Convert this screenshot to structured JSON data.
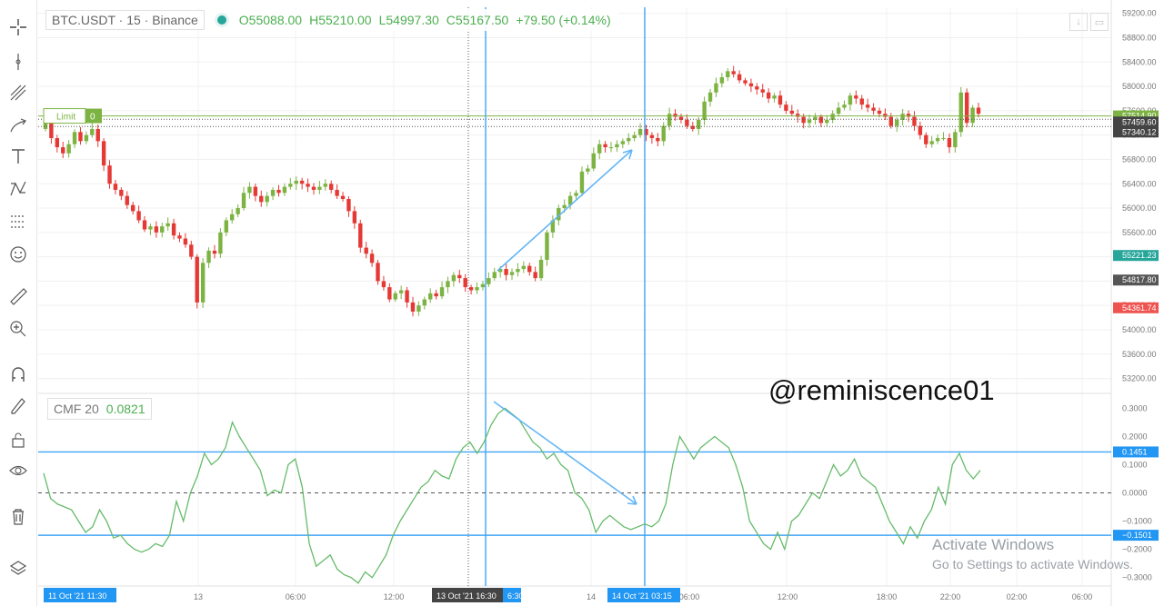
{
  "header": {
    "symbol": "BTC.USDT · 15 · Binance",
    "open": "O55088.00",
    "high": "H55210.00",
    "low": "L54997.30",
    "close": "C55167.50",
    "change": "+79.50 (+0.14%)"
  },
  "order_label": {
    "text": "Limit",
    "qty": "0"
  },
  "indicator": {
    "name": "CMF 20",
    "value": "0.0821"
  },
  "watermark": "@reminiscence01",
  "windows_notice": {
    "title": "Activate Windows",
    "subtitle": "Go to Settings to activate Windows."
  },
  "toolbar_icons": [
    "crosshair-icon",
    "line-tool-icon",
    "fib-tool-icon",
    "brush-icon",
    "text-tool-icon",
    "pattern-icon",
    "measure-grid-icon",
    "emoji-icon",
    "ruler-icon",
    "zoom-in-icon",
    "magnet-icon",
    "draw-lock-icon",
    "lock-icon",
    "eye-icon",
    "trash-icon",
    "layers-icon"
  ],
  "price_axis_ticks": [
    "59200.00",
    "58800.00",
    "58400.00",
    "58000.00",
    "57600.00",
    "57200.00",
    "56800.00",
    "56400.00",
    "56000.00",
    "55600.00",
    "55200.00",
    "54800.00",
    "54400.00",
    "54000.00",
    "53600.00",
    "53200.00"
  ],
  "price_tags": [
    {
      "value": "57514.90",
      "color": "#7cb342"
    },
    {
      "value": "57459.60",
      "color": "#444444"
    },
    {
      "value": "57340.12",
      "color": "#444444"
    },
    {
      "value": "55221.23",
      "color": "#26a69a"
    },
    {
      "value": "54817.80",
      "color": "#555555"
    },
    {
      "value": "54361.74",
      "color": "#ef5350"
    }
  ],
  "cmf_axis_ticks": [
    "0.3000",
    "0.2000",
    "0.1000",
    "0.0000",
    "−0.1000",
    "−0.2000",
    "−0.3000"
  ],
  "cmf_tags": [
    {
      "value": "0.1451",
      "color": "#2196f3"
    },
    {
      "value": "−0.1501",
      "color": "#2196f3"
    }
  ],
  "time_axis_ticks": [
    "13",
    "06:00",
    "12:00",
    "14",
    "06:00",
    "12:00",
    "18:00",
    "22:00",
    "02:00",
    "06:00"
  ],
  "time_markers": [
    {
      "text": "11 Oct '21   11:30",
      "color": "#2196f3"
    },
    {
      "text": "13 Oct '21   16:30",
      "color": "#444444"
    },
    {
      "text": "6:30",
      "color": "#2196f3"
    },
    {
      "text": "14 Oct '21   03:15",
      "color": "#2196f3"
    }
  ],
  "chart_data": [
    {
      "type": "candlestick",
      "title": "BTC.USDT · 15 · Binance",
      "ylim": [
        53000,
        59300
      ],
      "lines": [
        57514.9,
        57459.6,
        57340.12
      ],
      "closes": [
        57400,
        57150,
        57000,
        56900,
        57050,
        57250,
        57100,
        57200,
        57300,
        57100,
        56700,
        56400,
        56300,
        56200,
        56050,
        55950,
        55800,
        55650,
        55700,
        55600,
        55700,
        55750,
        55550,
        55500,
        55400,
        55200,
        54450,
        55100,
        55300,
        55250,
        55600,
        55800,
        55900,
        56000,
        56250,
        56350,
        56200,
        56100,
        56200,
        56300,
        56250,
        56350,
        56400,
        56450,
        56400,
        56350,
        56300,
        56350,
        56400,
        56300,
        56200,
        56150,
        55950,
        55750,
        55350,
        55250,
        55100,
        54800,
        54700,
        54500,
        54600,
        54650,
        54450,
        54300,
        54400,
        54500,
        54600,
        54550,
        54700,
        54800,
        54900,
        54850,
        54700,
        54650,
        54700,
        54750,
        54850,
        54950,
        55000,
        54900,
        54950,
        55000,
        55050,
        54950,
        54850,
        55150,
        55600,
        55800,
        56000,
        56050,
        56200,
        56250,
        56600,
        56650,
        56900,
        57050,
        57000,
        57000,
        57050,
        57100,
        57150,
        57200,
        57300,
        57200,
        57150,
        57100,
        57350,
        57550,
        57500,
        57450,
        57350,
        57300,
        57450,
        57750,
        57900,
        58050,
        58150,
        58250,
        58200,
        58100,
        58050,
        58000,
        57950,
        57900,
        57800,
        57850,
        57700,
        57600,
        57550,
        57500,
        57400,
        57450,
        57500,
        57400,
        57450,
        57550,
        57650,
        57700,
        57850,
        57800,
        57700,
        57650,
        57600,
        57550,
        57500,
        57350,
        57450,
        57550,
        57500,
        57350,
        57200,
        57050,
        57100,
        57150,
        57150,
        57000,
        57250,
        57900,
        57400,
        57650,
        57550
      ]
    },
    {
      "type": "line",
      "title": "CMF 20",
      "ylim": [
        -0.33,
        0.33
      ],
      "levels": [
        0.1451,
        -0.1501
      ],
      "zero_line": 0,
      "values": [
        0.07,
        -0.02,
        -0.04,
        -0.05,
        -0.06,
        -0.1,
        -0.14,
        -0.12,
        -0.06,
        -0.1,
        -0.16,
        -0.15,
        -0.18,
        -0.2,
        -0.21,
        -0.2,
        -0.18,
        -0.19,
        -0.15,
        -0.03,
        -0.1,
        0.0,
        0.06,
        0.14,
        0.1,
        0.12,
        0.16,
        0.25,
        0.2,
        0.16,
        0.12,
        0.08,
        -0.01,
        0.01,
        0.0,
        0.1,
        0.12,
        0.02,
        -0.18,
        -0.26,
        -0.24,
        -0.22,
        -0.27,
        -0.29,
        -0.3,
        -0.32,
        -0.28,
        -0.3,
        -0.26,
        -0.22,
        -0.15,
        -0.1,
        -0.06,
        -0.02,
        0.02,
        0.04,
        0.08,
        0.06,
        0.05,
        0.12,
        0.16,
        0.18,
        0.14,
        0.18,
        0.24,
        0.28,
        0.3,
        0.28,
        0.26,
        0.22,
        0.18,
        0.16,
        0.12,
        0.14,
        0.1,
        0.08,
        0.0,
        -0.02,
        -0.06,
        -0.14,
        -0.1,
        -0.08,
        -0.1,
        -0.12,
        -0.13,
        -0.12,
        -0.11,
        -0.12,
        -0.1,
        -0.04,
        0.1,
        0.2,
        0.16,
        0.12,
        0.16,
        0.18,
        0.2,
        0.18,
        0.16,
        0.1,
        0.02,
        -0.1,
        -0.14,
        -0.18,
        -0.2,
        -0.14,
        -0.2,
        -0.1,
        -0.08,
        -0.04,
        0.0,
        -0.02,
        0.04,
        0.1,
        0.06,
        0.08,
        0.12,
        0.06,
        0.04,
        0.02,
        -0.04,
        -0.1,
        -0.14,
        -0.18,
        -0.12,
        -0.16,
        -0.1,
        -0.06,
        0.02,
        -0.04,
        0.1,
        0.14,
        0.08,
        0.05,
        0.08
      ]
    }
  ]
}
